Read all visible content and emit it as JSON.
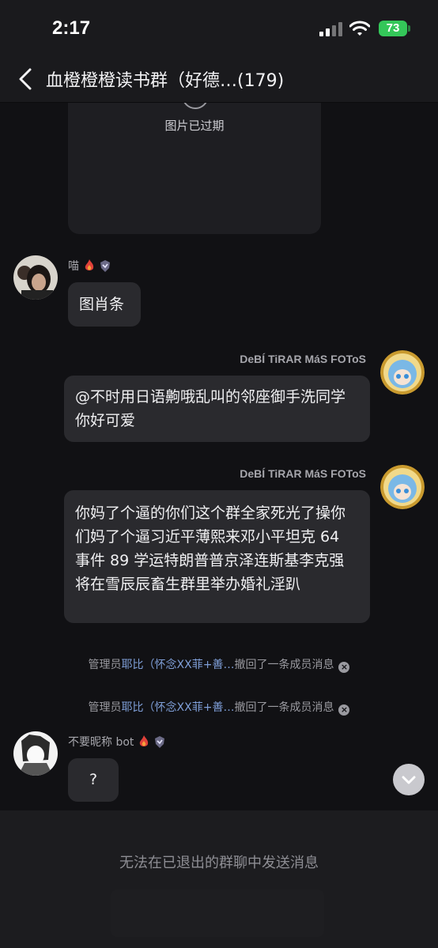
{
  "status_bar": {
    "time": "2:17",
    "battery": "73"
  },
  "header": {
    "title": "血橙橙橙读书群（好德…(179)",
    "back_icon": "chevron-left-icon"
  },
  "expired_image": {
    "label": "图片已过期"
  },
  "messages": [
    {
      "sender": "喵",
      "text": "图肖条",
      "side": "left"
    },
    {
      "sender": "DeBÍ TiRAR MáS FOToS",
      "text": "@不时用日语齁哦乱叫的邻座御手洗同学 你好可爱",
      "side": "right"
    },
    {
      "sender": "DeBÍ TiRAR MáS FOToS",
      "text": "你妈了个逼的你们这个群全家死光了操你们妈了个逼习近平薄熙来邓小平坦克 64 事件 89 学运特朗普普京泽连斯基李克强将在雪辰辰畜生群里举办婚礼淫趴",
      "side": "right"
    },
    {
      "sender": "不要昵称 bot",
      "text": "?",
      "side": "left"
    }
  ],
  "system_messages": [
    {
      "prefix": "管理员",
      "admin": "耶比（怀念XX菲+善…",
      "suffix": "撤回了一条成员消息"
    },
    {
      "prefix": "管理员",
      "admin": "耶比（怀念XX菲+善…",
      "suffix": "撤回了一条成员消息"
    }
  ],
  "footer": {
    "notice": "无法在已退出的群聊中发送消息"
  },
  "colors": {
    "background": "#111114",
    "bubble": "#2a2a2e",
    "admin_link": "#7f9fd8",
    "battery": "#34c759"
  }
}
